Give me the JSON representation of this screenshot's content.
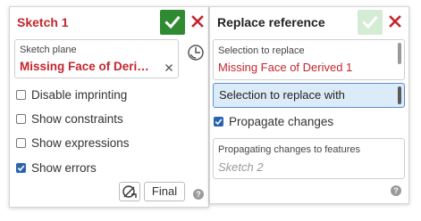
{
  "sketch_panel": {
    "title": "Sketch 1",
    "sketch_plane_label": "Sketch plane",
    "sketch_plane_value": "Missing Face of Deri…",
    "options": [
      {
        "label": "Disable imprinting",
        "checked": false
      },
      {
        "label": "Show constraints",
        "checked": false
      },
      {
        "label": "Show expressions",
        "checked": false
      },
      {
        "label": "Show errors",
        "checked": true
      }
    ],
    "final_label": "Final",
    "help_label": "?"
  },
  "replace_panel": {
    "title": "Replace reference",
    "selection_to_replace_label": "Selection to replace",
    "selection_to_replace_value": "Missing Face of Derived 1",
    "selection_with_label": "Selection to replace with",
    "propagate_label": "Propagate changes",
    "propagate_checked": true,
    "propagating_label": "Propagating changes to features",
    "propagating_value": "Sketch 2",
    "help_label": "?"
  },
  "colors": {
    "accent_red": "#c4262e",
    "accept_green": "#2f8a32",
    "accept_green_disabled": "#d5ecd4",
    "checkbox_blue": "#2a64b0",
    "active_field_bg": "#dcebf8"
  }
}
